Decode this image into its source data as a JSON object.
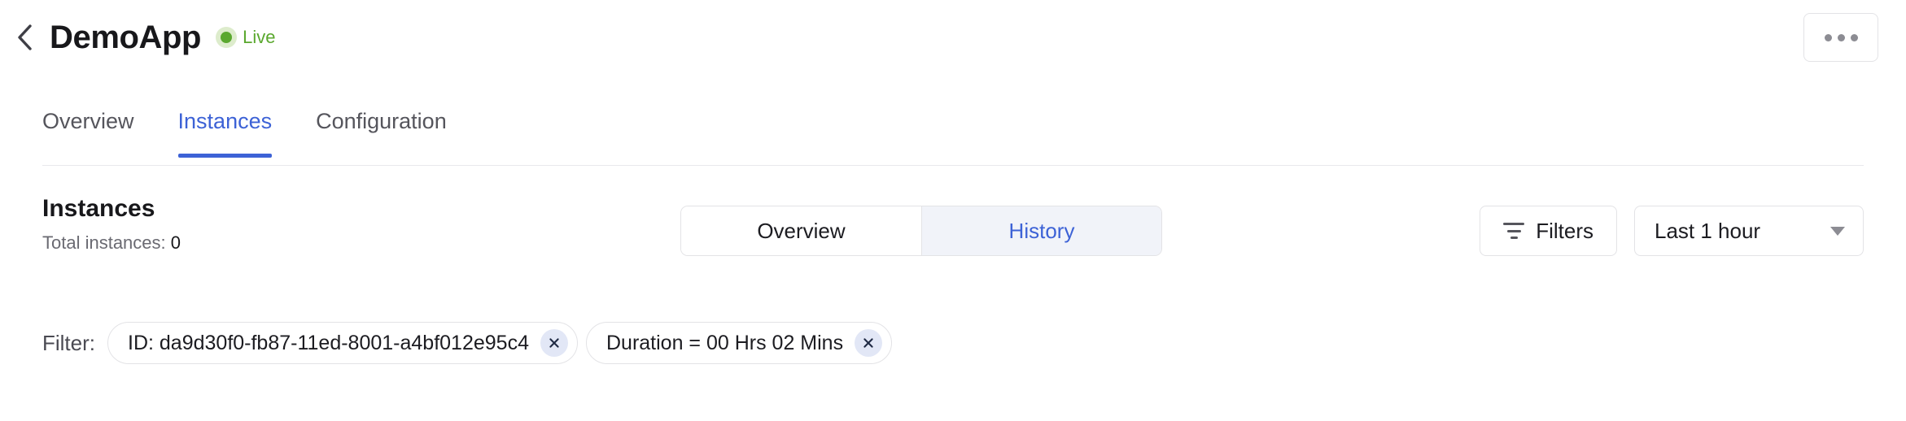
{
  "header": {
    "back_icon": "chevron-left-icon",
    "app_title": "DemoApp",
    "status_label": "Live",
    "status_color": "#5aa82e",
    "more_icon": "ellipsis-icon"
  },
  "tabs": [
    {
      "label": "Overview",
      "active": false
    },
    {
      "label": "Instances",
      "active": true
    },
    {
      "label": "Configuration",
      "active": false
    }
  ],
  "section": {
    "title": "Instances",
    "total_prefix": "Total instances:",
    "total_count": "0"
  },
  "segmented": {
    "options": [
      {
        "label": "Overview",
        "selected": false
      },
      {
        "label": "History",
        "selected": true
      }
    ],
    "selected_color": "#3d62d6"
  },
  "controls": {
    "filters_label": "Filters",
    "filters_icon": "filter-icon",
    "time_range_value": "Last 1 hour",
    "time_range_caret": "chevron-down-icon"
  },
  "filters": {
    "label": "Filter:",
    "chips": [
      {
        "text": "ID: da9d30f0-fb87-11ed-8001-a4bf012e95c4",
        "close_icon": "close-icon"
      },
      {
        "text": "Duration = 00 Hrs 02 Mins",
        "close_icon": "close-icon"
      }
    ]
  },
  "theme": {
    "accent": "#3d62d6",
    "background": "#ffffff",
    "border": "#e3e3e6"
  }
}
